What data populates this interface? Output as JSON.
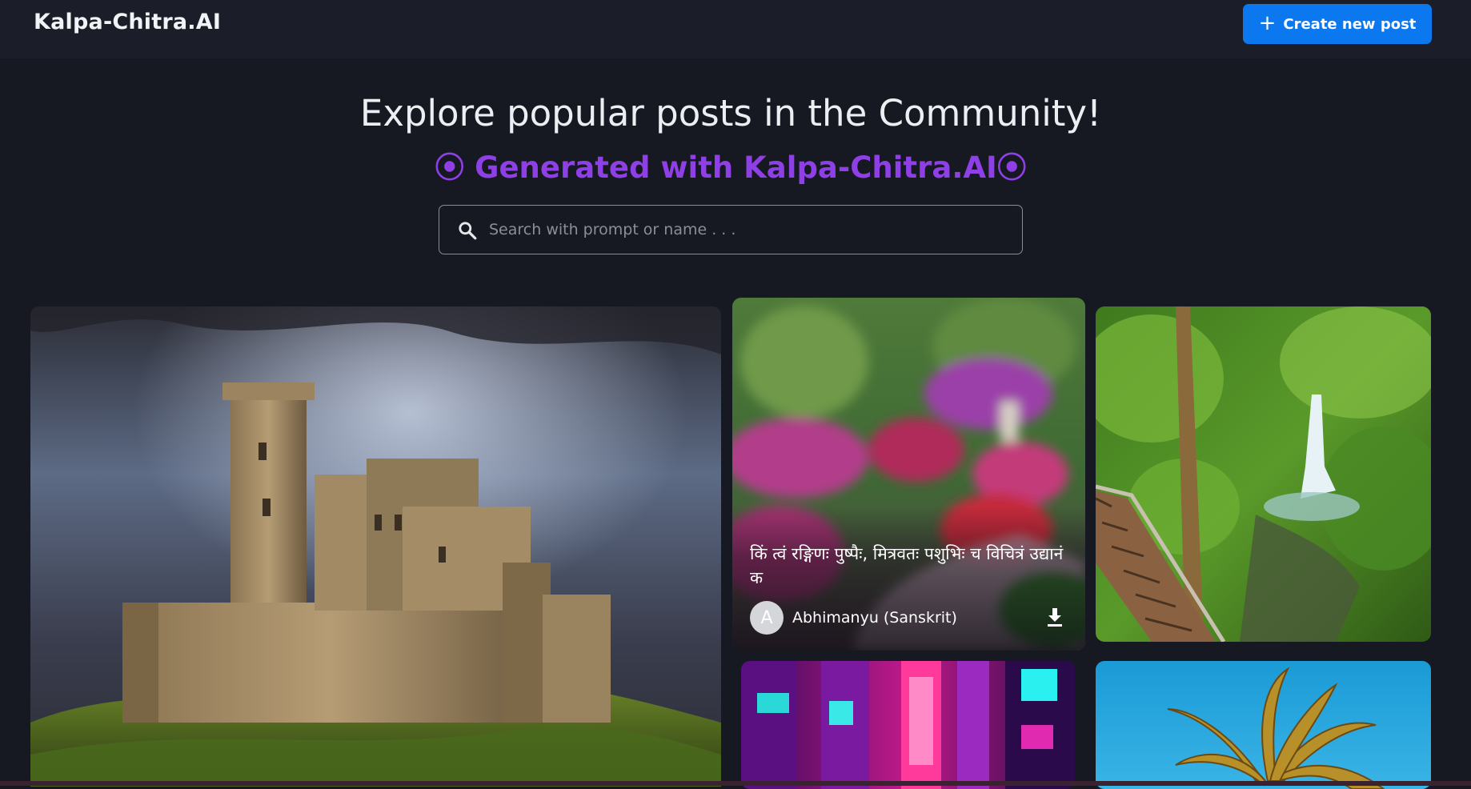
{
  "header": {
    "logo": "Kalpa-Chitra.AI",
    "create_button": {
      "icon": "plus-icon",
      "label": "Create new post"
    }
  },
  "hero": {
    "title": "Explore popular posts in the Community!",
    "subtitle": "⦿ Generated with Kalpa-Chitra.AI⦿"
  },
  "search": {
    "icon": "search-icon",
    "placeholder": "Search with prompt or name . . ."
  },
  "posts": [
    {
      "image": "castle on a green hill under storm clouds"
    },
    {
      "image": "flower garden with pink and red blossoms",
      "prompt": "किं त्वं रङ्गिणः पुष्पैः, मित्रवतः पशुभिः च विचित्रं उद्यानं क",
      "author_initial": "A",
      "author": "Abhimanyu (Sanskrit)",
      "download_icon": "download-icon"
    },
    {
      "image": "jungle waterfall with wooden boardwalk"
    },
    {
      "image": "neon cyberpunk city street"
    },
    {
      "image": "palm tree against blue sky"
    }
  ],
  "colors": {
    "background": "#161922",
    "header": "#1b1e28",
    "accent_button": "#0b78f0",
    "subtitle_purple": "#8f3fe6"
  }
}
